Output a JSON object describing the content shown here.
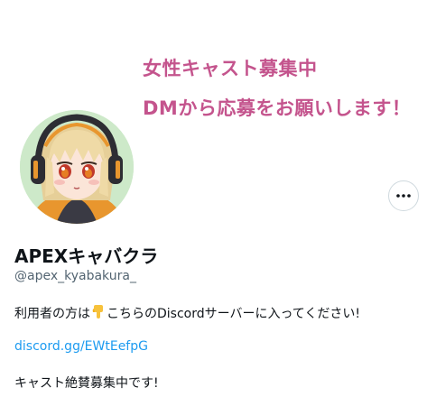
{
  "banner": {
    "line1": "女性キャスト募集中",
    "line2": "DMから応募をお願いします！"
  },
  "profile": {
    "display_name": "APEXキャバクラ",
    "handle": "@apex_kyabakura_",
    "bio_line1_before": "利用者の方は",
    "bio_line1_after": "こちらのDiscordサーバーに入ってください!",
    "link": "discord.gg/EWtEefpG",
    "bio_line3": "キャスト絶賛募集中です!"
  },
  "icons": {
    "more": "more-options-icon",
    "emoji": "pointing-down-hand-emoji"
  },
  "colors": {
    "banner_text": "#c4548d",
    "link": "#1d9bf0",
    "handle": "#536471",
    "text": "#0f1419"
  }
}
